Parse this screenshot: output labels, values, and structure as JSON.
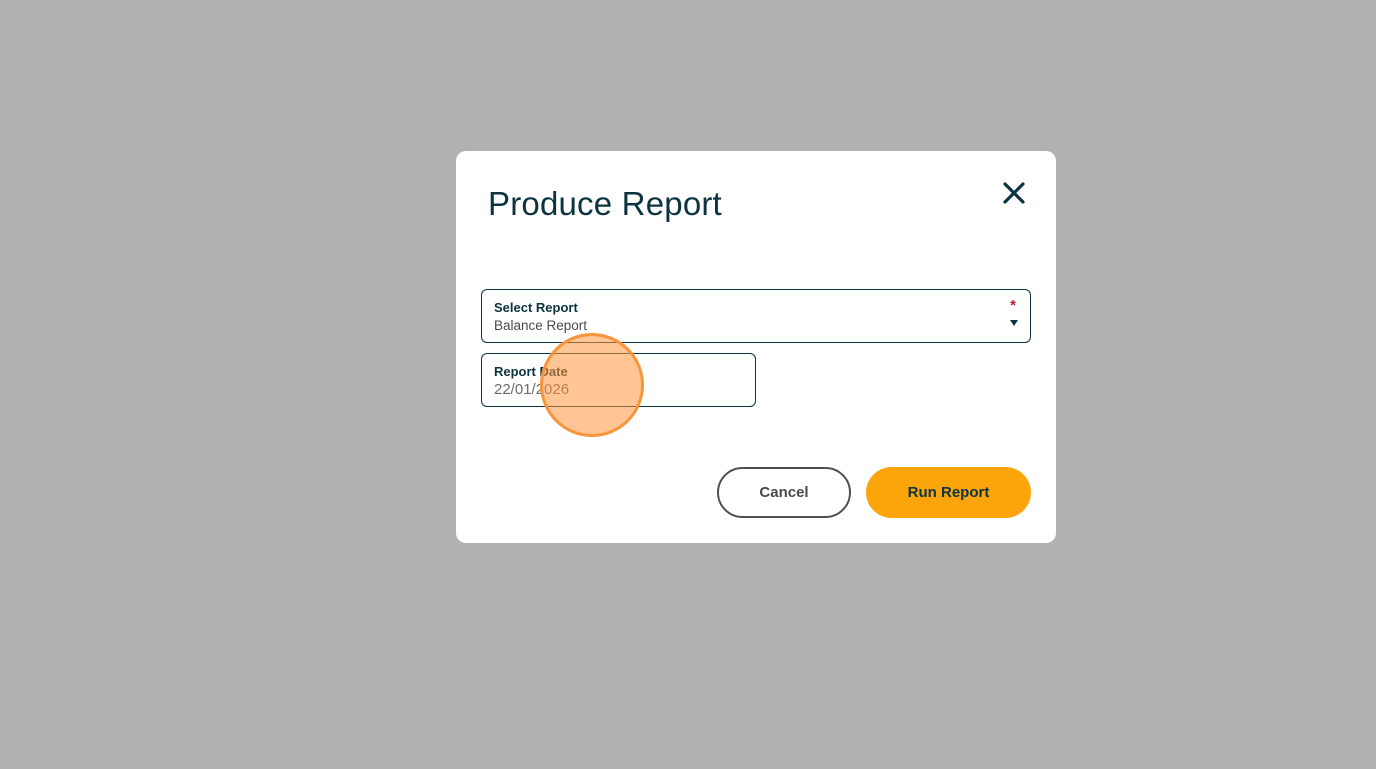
{
  "dialog": {
    "title": "Produce Report",
    "close_icon": "close-icon",
    "close_symbol": "✕"
  },
  "select_report": {
    "label": "Select Report",
    "value": "Balance Report",
    "required_mark": "*",
    "dropdown_icon": "caret-down-icon"
  },
  "report_date": {
    "label": "Report Date",
    "value": "22/01/2026"
  },
  "actions": {
    "cancel_label": "Cancel",
    "run_label": "Run Report"
  },
  "colors": {
    "overlay": "#b1b1b1",
    "dialog_background": "#ffffff",
    "primary_text": "#0b3340",
    "accent": "#fca50a",
    "required": "#c0172b",
    "click_indicator": "#f7953a"
  }
}
